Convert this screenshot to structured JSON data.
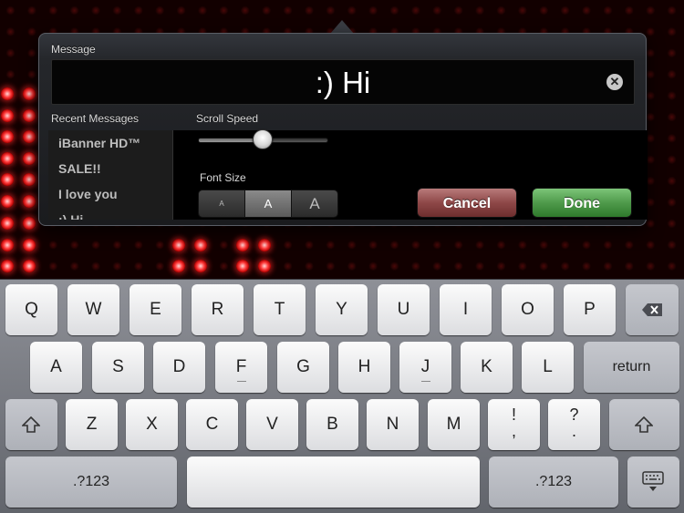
{
  "popover": {
    "message_label": "Message",
    "message_value": ":) Hi",
    "clear_glyph": "✕",
    "recent_label": "Recent Messages",
    "recent_items": [
      "iBanner HD™",
      "SALE!!",
      "I love you",
      ":) Hi"
    ],
    "scroll_speed_label": "Scroll Speed",
    "scroll_speed_value": 0.5,
    "font_size_label": "Font Size",
    "font_sizes": [
      "A",
      "A",
      "A"
    ],
    "font_size_selected": 1,
    "cancel_label": "Cancel",
    "done_label": "Done"
  },
  "keyboard": {
    "row1": [
      "Q",
      "W",
      "E",
      "R",
      "T",
      "Y",
      "U",
      "I",
      "O",
      "P"
    ],
    "row2": [
      "A",
      "S",
      "D",
      "F",
      "G",
      "H",
      "J",
      "K",
      "L"
    ],
    "row3": [
      "Z",
      "X",
      "C",
      "V",
      "B",
      "N",
      "M"
    ],
    "return_label": "return",
    "numbers_label": ".?123",
    "exclaim_top": "!",
    "exclaim_bottom": ",",
    "question_top": "?",
    "question_bottom": ".",
    "icons": {
      "backspace": "backspace-icon",
      "shift": "shift-icon",
      "hide_keyboard": "keyboard-hide-icon"
    }
  },
  "colors": {
    "led_on": "#ff3a3a",
    "cancel": "#8e4848",
    "done": "#4f9a4b"
  }
}
